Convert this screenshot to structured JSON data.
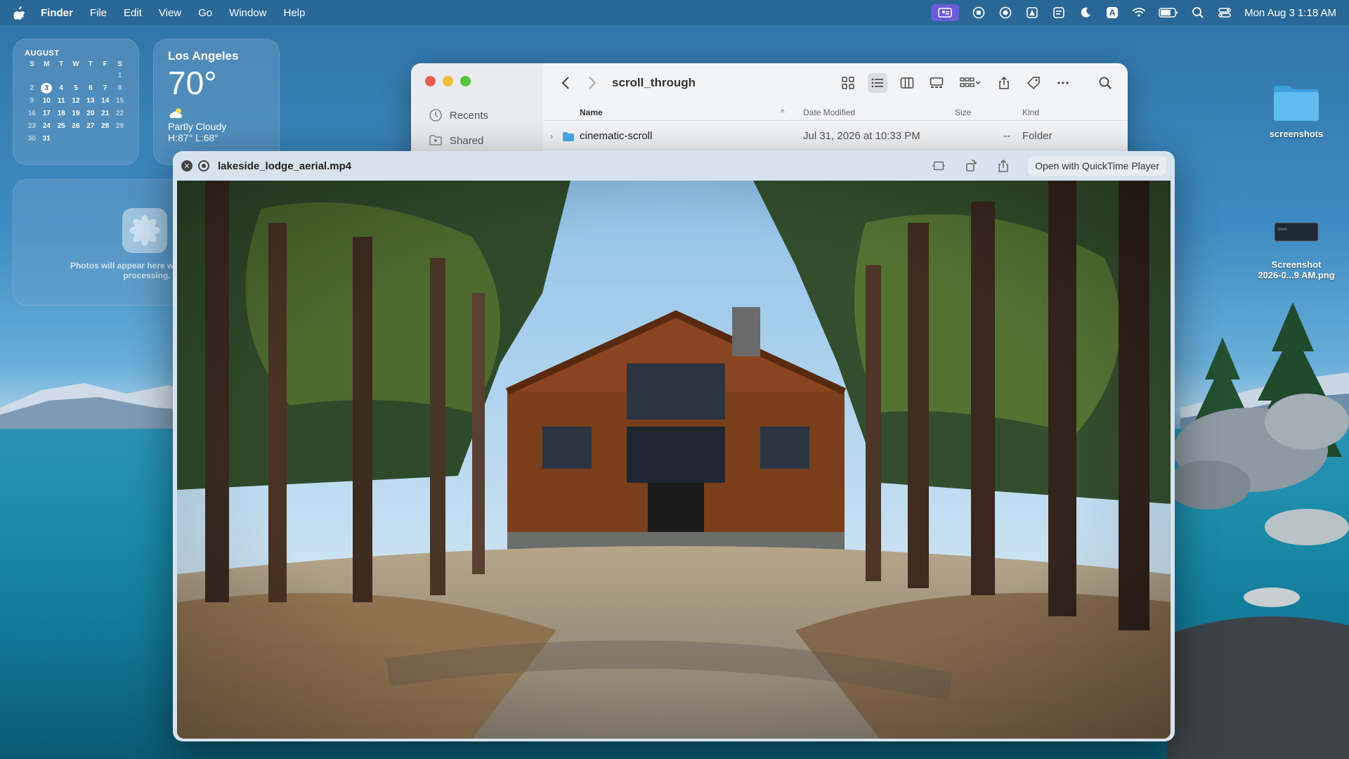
{
  "menubar": {
    "app_name": "Finder",
    "menus": [
      "File",
      "Edit",
      "View",
      "Go",
      "Window",
      "Help"
    ],
    "clock": "Mon Aug 3  1:18 AM",
    "input_source": "A"
  },
  "calendar": {
    "month": "AUGUST",
    "weekday_headers": [
      "S",
      "M",
      "T",
      "W",
      "T",
      "F",
      "S"
    ],
    "weeks": [
      [
        "",
        "",
        "",
        "",
        "",
        "",
        "1"
      ],
      [
        "2",
        "3",
        "4",
        "5",
        "6",
        "7",
        "8"
      ],
      [
        "9",
        "10",
        "11",
        "12",
        "13",
        "14",
        "15"
      ],
      [
        "16",
        "17",
        "18",
        "19",
        "20",
        "21",
        "22"
      ],
      [
        "23",
        "24",
        "25",
        "26",
        "27",
        "28",
        "29"
      ],
      [
        "30",
        "31",
        "",
        "",
        "",
        "",
        ""
      ]
    ],
    "today": "3"
  },
  "weather": {
    "city": "Los Angeles",
    "temp": "70°",
    "condition": "Partly Cloudy",
    "hilo": "H:87° L:68°"
  },
  "photos_widget": {
    "message": "Photos will appear here when finished processing."
  },
  "desktop": {
    "folder_label": "screenshots",
    "screenshot_label_line1": "Screenshot",
    "screenshot_label_line2": "2026-0...9 AM.png"
  },
  "finder": {
    "sidebar": [
      {
        "label": "Recents",
        "icon": "clock-icon"
      },
      {
        "label": "Shared",
        "icon": "shared-folder-icon"
      }
    ],
    "title": "scroll_through",
    "columns": {
      "name": "Name",
      "date": "Date Modified",
      "size": "Size",
      "kind": "Kind"
    },
    "rows": [
      {
        "name": "cinematic-scroll",
        "date": "Jul 31, 2026 at 10:33 PM",
        "size": "--",
        "kind": "Folder"
      }
    ]
  },
  "quicklook": {
    "filename": "lakeside_lodge_aerial.mp4",
    "open_with": "Open with QuickTime Player"
  }
}
